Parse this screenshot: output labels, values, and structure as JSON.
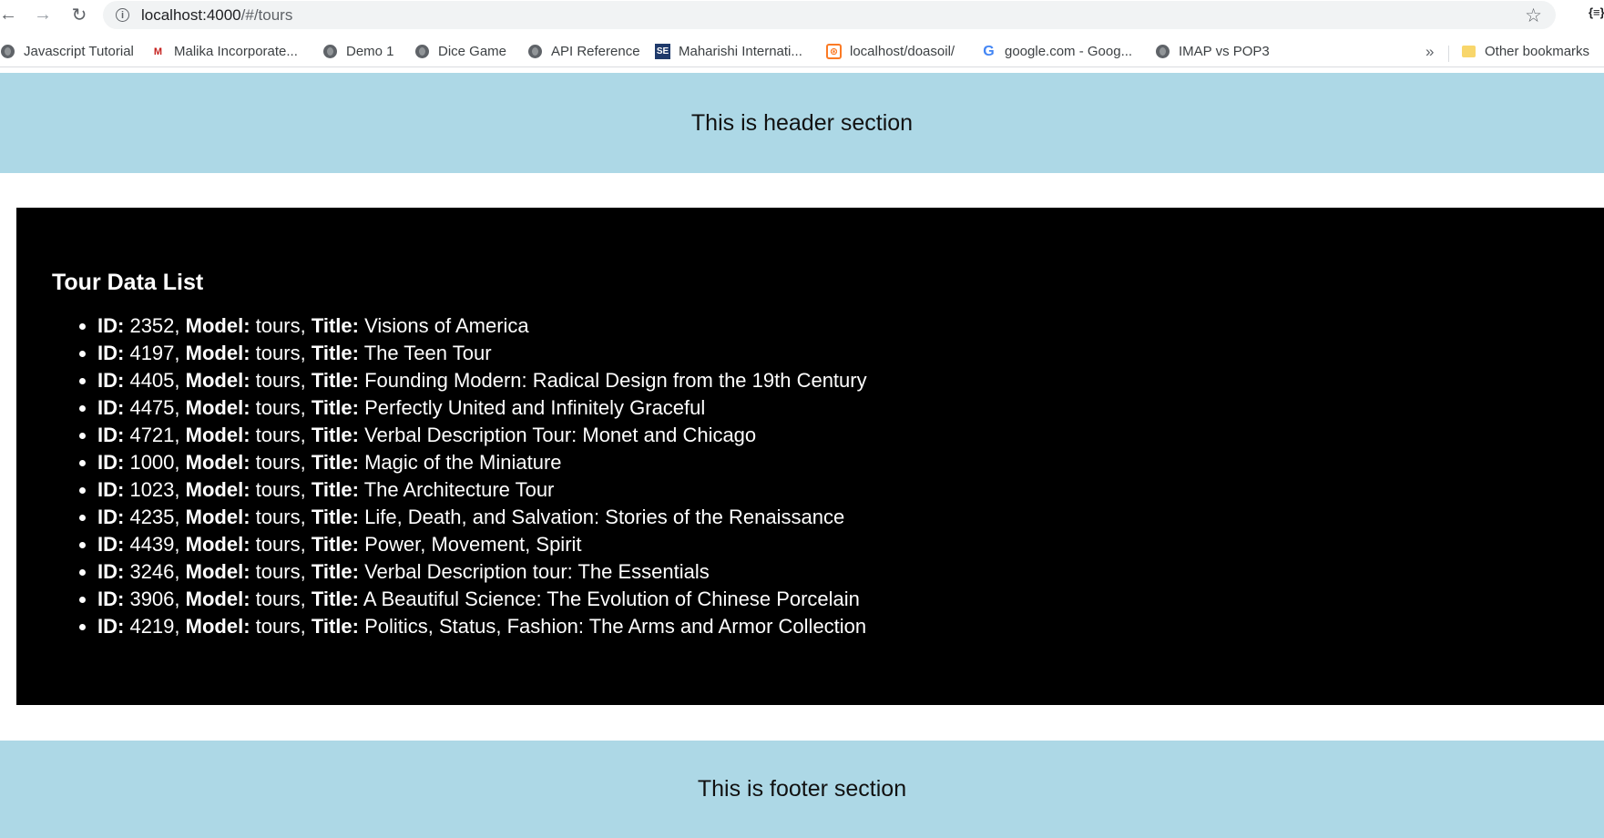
{
  "browser": {
    "url_host": "localhost:4000",
    "url_path": "/#/tours",
    "bookmarks": [
      {
        "label": "Javascript Tutorial",
        "icon": "globe-icon"
      },
      {
        "label": "Malika Incorporate...",
        "icon": "mail-icon"
      },
      {
        "label": "Demo 1",
        "icon": "globe-icon"
      },
      {
        "label": "Dice Game",
        "icon": "globe-icon"
      },
      {
        "label": "API Reference",
        "icon": "globe-icon"
      },
      {
        "label": "Maharishi Internati...",
        "icon": "se-icon"
      },
      {
        "label": "localhost/doasoil/",
        "icon": "xampp-icon"
      },
      {
        "label": "google.com - Goog...",
        "icon": "google-icon"
      },
      {
        "label": "IMAP vs POP3",
        "icon": "globe-icon"
      }
    ],
    "more_bookmarks": "»",
    "other_bookmarks": "Other bookmarks"
  },
  "header": {
    "text": "This is header section"
  },
  "main": {
    "title": "Tour Data List",
    "labels": {
      "id": "ID:",
      "model": "Model:",
      "title": "Title:"
    },
    "tours": [
      {
        "id": "2352",
        "model": "tours",
        "title": "Visions of America"
      },
      {
        "id": "4197",
        "model": "tours",
        "title": "The Teen Tour"
      },
      {
        "id": "4405",
        "model": "tours",
        "title": "Founding Modern: Radical Design from the 19th Century"
      },
      {
        "id": "4475",
        "model": "tours",
        "title": "Perfectly United and Infinitely Graceful"
      },
      {
        "id": "4721",
        "model": "tours",
        "title": "Verbal Description Tour: Monet and Chicago"
      },
      {
        "id": "1000",
        "model": "tours",
        "title": "Magic of the Miniature"
      },
      {
        "id": "1023",
        "model": "tours",
        "title": "The Architecture Tour"
      },
      {
        "id": "4235",
        "model": "tours",
        "title": "Life, Death, and Salvation: Stories of the Renaissance"
      },
      {
        "id": "4439",
        "model": "tours",
        "title": "Power, Movement, Spirit"
      },
      {
        "id": "3246",
        "model": "tours",
        "title": "Verbal Description tour: The Essentials"
      },
      {
        "id": "3906",
        "model": "tours",
        "title": "A Beautiful Science: The Evolution of Chinese Porcelain"
      },
      {
        "id": "4219",
        "model": "tours",
        "title": "Politics, Status, Fashion: The Arms and Armor Collection"
      }
    ]
  },
  "footer": {
    "text": "This is footer section"
  },
  "colors": {
    "header_bg": "#add8e6",
    "main_bg": "#000000",
    "main_text": "#ffffff"
  }
}
